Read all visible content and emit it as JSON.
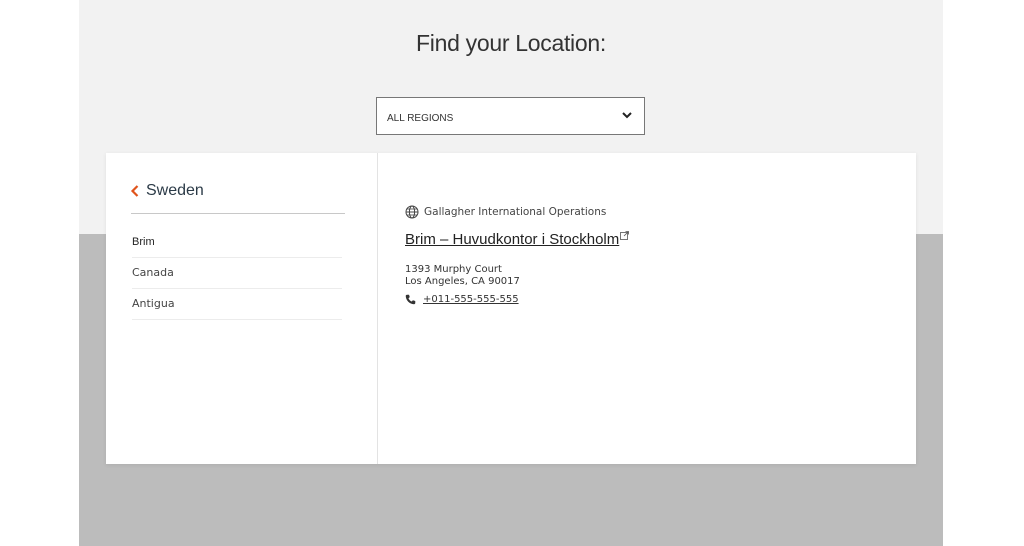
{
  "header": {
    "title": "Find your Location:"
  },
  "region_select": {
    "selected": "ALL REGIONS"
  },
  "sidebar": {
    "back_label": "Sweden",
    "countries": [
      {
        "label": "Brim"
      },
      {
        "label": "Canada"
      },
      {
        "label": "Antigua"
      }
    ]
  },
  "office": {
    "type": "Gallagher International Operations",
    "name": "Brim – Huvudkontor i Stockholm",
    "address_line1": "1393 Murphy Court",
    "address_line2": "Los Angeles, CA 90017",
    "phone": "+011-555-555-555"
  },
  "colors": {
    "accent": "#e0541c",
    "page_top_bg": "#f2f2f2",
    "page_bottom_bg": "#bcbcbc"
  }
}
